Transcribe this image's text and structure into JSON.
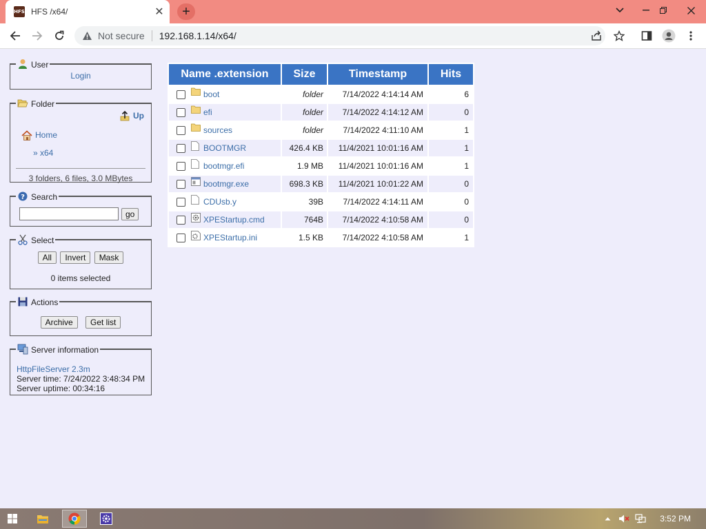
{
  "browser": {
    "tab_title": "HFS /x64/",
    "favicon_text": "HFS",
    "security_label": "Not secure",
    "url": "192.168.1.14/x64/"
  },
  "sidebar": {
    "user": {
      "legend": "User",
      "login_label": "Login"
    },
    "folder": {
      "legend": "Folder",
      "up_label": "Up",
      "home_label": "Home",
      "current_label": "» x64",
      "summary": "3 folders, 6 files, 3.0 MBytes"
    },
    "search": {
      "legend": "Search",
      "placeholder": "",
      "go_label": "go"
    },
    "select": {
      "legend": "Select",
      "all_label": "All",
      "invert_label": "Invert",
      "mask_label": "Mask",
      "status": "0 items selected"
    },
    "actions": {
      "legend": "Actions",
      "archive_label": "Archive",
      "getlist_label": "Get list"
    },
    "server": {
      "legend": "Server information",
      "product_link": "HttpFileServer 2.3m",
      "time": "Server time: 7/24/2022 3:48:34 PM",
      "uptime": "Server uptime: 00:34:16"
    }
  },
  "table": {
    "headers": {
      "name": "Name .extension",
      "size": "Size",
      "timestamp": "Timestamp",
      "hits": "Hits"
    },
    "rows": [
      {
        "name": "boot",
        "icon": "folder-icon",
        "size": "folder",
        "timestamp": "7/14/2022 4:14:14 AM",
        "hits": "6"
      },
      {
        "name": "efi",
        "icon": "folder-icon",
        "size": "folder",
        "timestamp": "7/14/2022 4:14:12 AM",
        "hits": "0"
      },
      {
        "name": "sources",
        "icon": "folder-icon",
        "size": "folder",
        "timestamp": "7/14/2022 4:11:10 AM",
        "hits": "1"
      },
      {
        "name": "BOOTMGR",
        "icon": "file-icon",
        "size": "426.4 KB",
        "timestamp": "11/4/2021 10:01:16 AM",
        "hits": "1"
      },
      {
        "name": "bootmgr.efi",
        "icon": "file-icon",
        "size": "1.9 MB",
        "timestamp": "11/4/2021 10:01:16 AM",
        "hits": "1"
      },
      {
        "name": "bootmgr.exe",
        "icon": "exe-icon",
        "size": "698.3 KB",
        "timestamp": "11/4/2021 10:01:22 AM",
        "hits": "0"
      },
      {
        "name": "CDUsb.y",
        "icon": "file-icon",
        "size": "39B",
        "timestamp": "7/14/2022 4:14:11 AM",
        "hits": "0"
      },
      {
        "name": "XPEStartup.cmd",
        "icon": "cmd-icon",
        "size": "764B",
        "timestamp": "7/14/2022 4:10:58 AM",
        "hits": "0"
      },
      {
        "name": "XPEStartup.ini",
        "icon": "ini-icon",
        "size": "1.5 KB",
        "timestamp": "7/14/2022 4:10:58 AM",
        "hits": "1"
      }
    ]
  },
  "taskbar": {
    "clock": "3:52 PM"
  },
  "colors": {
    "header_blue": "#3a74c4",
    "page_bg": "#eeedfb",
    "tabbar": "#f28b82",
    "link": "#3c6ea8"
  }
}
